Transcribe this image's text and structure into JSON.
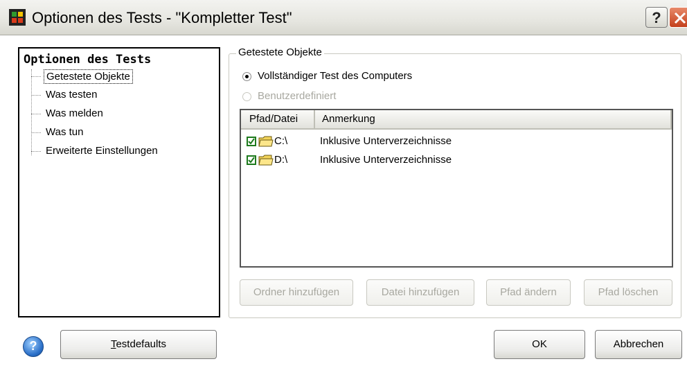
{
  "window": {
    "title": "Optionen des Tests - \"Kompletter Test\"",
    "help_button": "?",
    "close_button": "X"
  },
  "tree": {
    "root": "Optionen des Tests",
    "items": [
      {
        "label": "Getestete Objekte",
        "selected": true
      },
      {
        "label": "Was testen",
        "selected": false
      },
      {
        "label": "Was melden",
        "selected": false
      },
      {
        "label": "Was tun",
        "selected": false
      },
      {
        "label": "Erweiterte Einstellungen",
        "selected": false
      }
    ]
  },
  "group": {
    "legend": "Getestete Objekte",
    "radio_full": "Vollständiger Test des Computers",
    "radio_custom": "Benutzerdefiniert"
  },
  "list": {
    "columns": [
      "Pfad/Datei",
      "Anmerkung"
    ],
    "rows": [
      {
        "path": "C:\\",
        "note": "Inklusive Unterverzeichnisse",
        "checked": true
      },
      {
        "path": "D:\\",
        "note": "Inklusive Unterverzeichnisse",
        "checked": true
      }
    ]
  },
  "actions": {
    "add_folder": "Ordner hinzufügen",
    "add_file": "Datei hinzufügen",
    "change_path": "Pfad ändern",
    "delete_path": "Pfad löschen"
  },
  "footer": {
    "help_icon": "?",
    "defaults_prefix": "T",
    "defaults_rest": "estdefaults",
    "ok": "OK",
    "cancel": "Abbrechen"
  },
  "colors": {
    "check_green": "#1d7a1d",
    "close_red": "#c4401c",
    "disabled_text": "#a8a8a0"
  }
}
